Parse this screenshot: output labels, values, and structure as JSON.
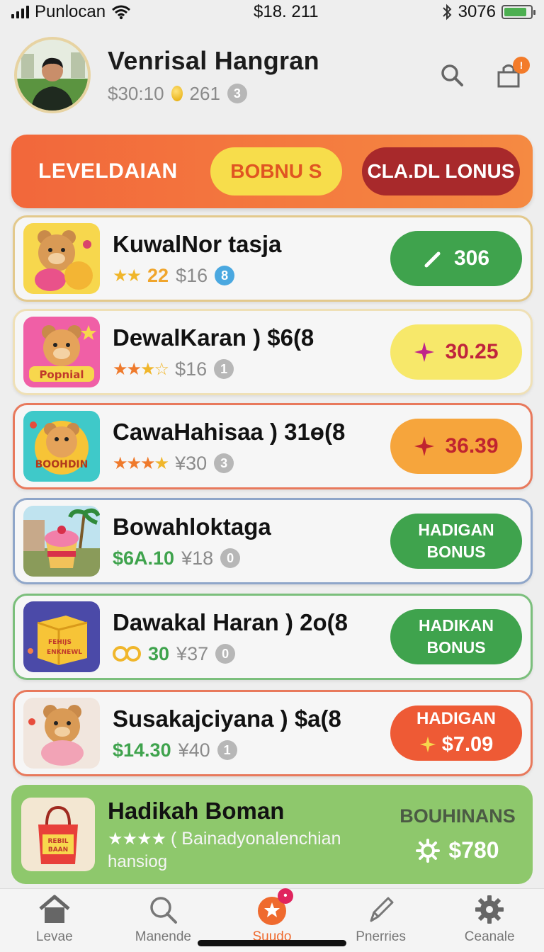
{
  "status_bar": {
    "carrier": "Punlocan",
    "time": "$18. 211",
    "battery_text": "3076",
    "battery_level": 0.85
  },
  "profile": {
    "name": "Venrisal Hangran",
    "balance": "$30:10",
    "coins": "261",
    "badge": "3"
  },
  "banner": {
    "level_label": "LEVELDAIAN",
    "bonus_label": "BOBNU S",
    "claim_label": "CLA.DL LONUS"
  },
  "offers": [
    {
      "title": "KuwalNor tasja",
      "rating_value": "22",
      "price": "$16",
      "badge": "8",
      "action_label": "306",
      "action_icon": "pencil-icon"
    },
    {
      "title": "DewalKaran ) $6(8",
      "price": "$16",
      "badge": "1",
      "action_label": "30.25",
      "action_icon": "sparkle-icon"
    },
    {
      "title": "CawaHahisaa ) 31ө(8",
      "price": "¥30",
      "badge": "3",
      "action_label": "36.39",
      "action_icon": "sparkle-icon"
    },
    {
      "title": "Bowahloktaga",
      "amount": "$6A.10",
      "price": "¥18",
      "badge": "0",
      "action_line1": "HADIGAN",
      "action_line2": "BONUS"
    },
    {
      "title": "Dawakal Haran ) 2o(8",
      "amount": "30",
      "price": "¥37",
      "badge": "0",
      "action_line1": "HADIKAN",
      "action_line2": "BONUS"
    },
    {
      "title": "Susakajciyana ) $a(8",
      "amount": "$14.30",
      "price": "¥40",
      "badge": "1",
      "action_line1": "HADIGAN",
      "action_line2": "$7.09"
    }
  ],
  "featured": {
    "title": "Hadikah Boman",
    "subtitle": "( Bainadyonalenchian",
    "subtitle2": "hansiog",
    "label": "BOUHINANS",
    "price": "$780"
  },
  "nav": [
    {
      "label": "Levae",
      "icon": "home-icon"
    },
    {
      "label": "Manende",
      "icon": "search-icon"
    },
    {
      "label": "Suudo",
      "icon": "star-icon",
      "badge": "•"
    },
    {
      "label": "Pnerries",
      "icon": "pen-icon"
    },
    {
      "label": "Ceanale",
      "icon": "gear-icon"
    }
  ],
  "colors": {
    "accent_orange": "#f2673b",
    "bonus_yellow": "#f7dd4b",
    "claim_red": "#a8292b",
    "action_green": "#3fa34d",
    "featured_green": "#8ec86c"
  }
}
